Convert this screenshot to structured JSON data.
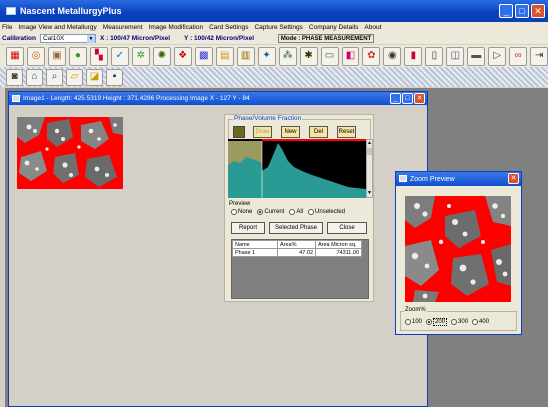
{
  "app": {
    "title": "Nascent MetallurgyPlus"
  },
  "window_buttons": {
    "minimize": "_",
    "maximize": "□",
    "close": "✕"
  },
  "menu": [
    "File",
    "Image View and Metallurgy",
    "Measurement",
    "Image Modification",
    "Card Settings",
    "Capture Settings",
    "Company Details",
    "About"
  ],
  "calibration": {
    "label": "Calibration",
    "selected": "Cal10X",
    "x_scale": "X : 100/47  Micron/Pixel",
    "y_scale": "Y : 100/42  Micron/Pixel",
    "mode": "Mode : PHASE MEASUREMENT"
  },
  "toolbar_icons": [
    "grid-icon",
    "target-icon",
    "portrait-icon",
    "sphere-icon",
    "color-blocks-icon",
    "chart-check-icon",
    "cell-icon",
    "spark-icon",
    "cluster-icon",
    "pattern-icon",
    "gold-frame-icon",
    "film-icon",
    "fish-icon",
    "dots-icon",
    "spider-icon",
    "measure-icon",
    "layers-icon",
    "flower-icon",
    "eye-icon",
    "book-icon",
    "report-icon",
    "print-preview-icon",
    "printer-icon",
    "play-icon",
    "link-icon",
    "exit-icon"
  ],
  "toolbar2_icons": [
    "camera-icon",
    "house-icon",
    "zoom-icon",
    "folder-new-icon",
    "folder-open-icon",
    "save-icon"
  ],
  "image_window": {
    "title": "Image1 - Length: 425.5319 Height : 371.4286 Processing Image  X  - 127   Y  - 84"
  },
  "phase": {
    "legend": "Phase/Volume Fraction",
    "buttons": {
      "draw": "Draw",
      "new": "New",
      "del": "Del",
      "reset": "Reset"
    },
    "preview_label": "Preview",
    "preview_options": [
      "None",
      "Current",
      "All",
      "Unselected"
    ],
    "preview_selected": "Current",
    "actions": {
      "report": "Report",
      "selected_phase": "Selected Phase",
      "close": "Close"
    },
    "table": {
      "headers": [
        "Name",
        "Area%",
        "Area Micron sq."
      ],
      "rows": [
        [
          "Phase  1",
          "47.02",
          "74311.00"
        ]
      ]
    },
    "colors": {
      "histogram_fill": "#2a9a94",
      "selection": "#6b6a1f",
      "marker": "#ff0000"
    }
  },
  "zoom": {
    "title": "Zoom Preview",
    "legend": "Zoom%",
    "options": [
      "100",
      "200",
      "300",
      "400"
    ],
    "selected": "200"
  }
}
